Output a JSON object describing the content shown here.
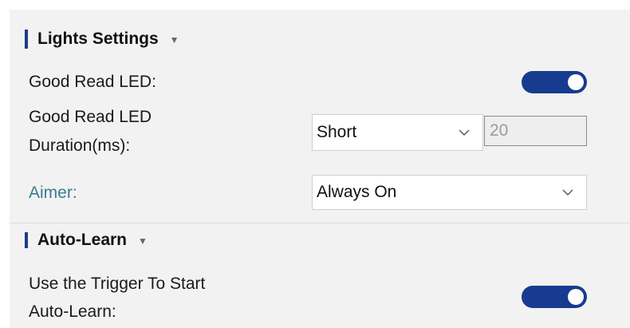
{
  "lights_section": {
    "title": "Lights Settings",
    "good_read_led_label": "Good Read LED:",
    "good_read_led_on": true,
    "duration_label_line1": "Good Read LED",
    "duration_label_line2": "Duration(ms):",
    "duration_select_value": "Short",
    "duration_input_value": "20",
    "aimer_label": "Aimer:",
    "aimer_select_value": "Always On"
  },
  "autolearn_section": {
    "title": "Auto-Learn",
    "trigger_label_line1": "Use the Trigger To Start",
    "trigger_label_line2": "Auto-Learn:",
    "trigger_on": true
  },
  "colors": {
    "toggle_on": "#173b8f",
    "section_bar": "#1f3a8a",
    "aimer_label": "#3a7d8c"
  },
  "icons": {
    "section_caret": "caret-down-icon",
    "select_chevron": "chevron-down-icon"
  }
}
